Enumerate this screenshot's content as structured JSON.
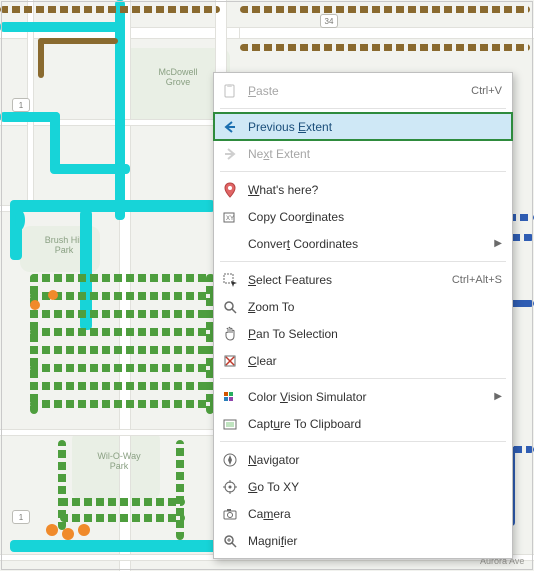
{
  "map": {
    "labels": {
      "mcdowell": "McDowell\nGrove",
      "brushhill": "Brush Hill\nPark",
      "wiloway": "Wil-O-Way\nPark",
      "aurora": "Aurora Ave"
    },
    "shields": {
      "one": "1",
      "thirtyfour": "34",
      "one_b": "1"
    }
  },
  "menu": {
    "paste": "Paste",
    "paste_shortcut": "Ctrl+V",
    "previous_extent": "Previous Extent",
    "next_extent": "Next Extent",
    "whats_here": "What's here?",
    "copy_coordinates": "Copy Coordinates",
    "convert_coordinates": "Convert Coordinates",
    "select_features": "Select Features",
    "select_shortcut": "Ctrl+Alt+S",
    "zoom_to": "Zoom To",
    "pan_to_selection": "Pan To Selection",
    "clear": "Clear",
    "color_vision": "Color Vision Simulator",
    "capture_clipboard": "Capture To Clipboard",
    "navigator": "Navigator",
    "go_to_xy": "Go To XY",
    "camera": "Camera",
    "magnifier": "Magnifier"
  }
}
